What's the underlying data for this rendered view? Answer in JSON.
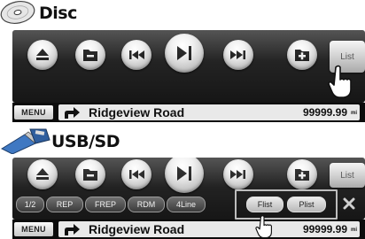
{
  "disc_section": {
    "title": "Disc",
    "list_label": "List",
    "menu_label": "MENU",
    "road_name": "Ridgeview Road",
    "distance": "99999.99",
    "distance_unit": "mi"
  },
  "usb_section": {
    "title": "USB/SD",
    "list_label": "List",
    "menu_label": "MENU",
    "road_name": "Ridgeview Road",
    "distance": "99999.99",
    "distance_unit": "mi",
    "function_buttons": [
      "1/2",
      "REP",
      "FREP",
      "RDM",
      "4Line",
      "Flist",
      "Plist"
    ]
  },
  "icons": [
    "disc-icon",
    "usb-sd-icon",
    "eject-icon",
    "folder-down-icon",
    "previous-track-icon",
    "play-pause-icon",
    "next-track-icon",
    "folder-up-icon",
    "right-turn-arrow-icon",
    "close-icon",
    "pointing-hand-icon"
  ],
  "colors": {
    "panel": "#232323",
    "button_face": "#e8e8e8",
    "status_bar": "#0c0c0c",
    "road_box": "#e9e9e9"
  }
}
